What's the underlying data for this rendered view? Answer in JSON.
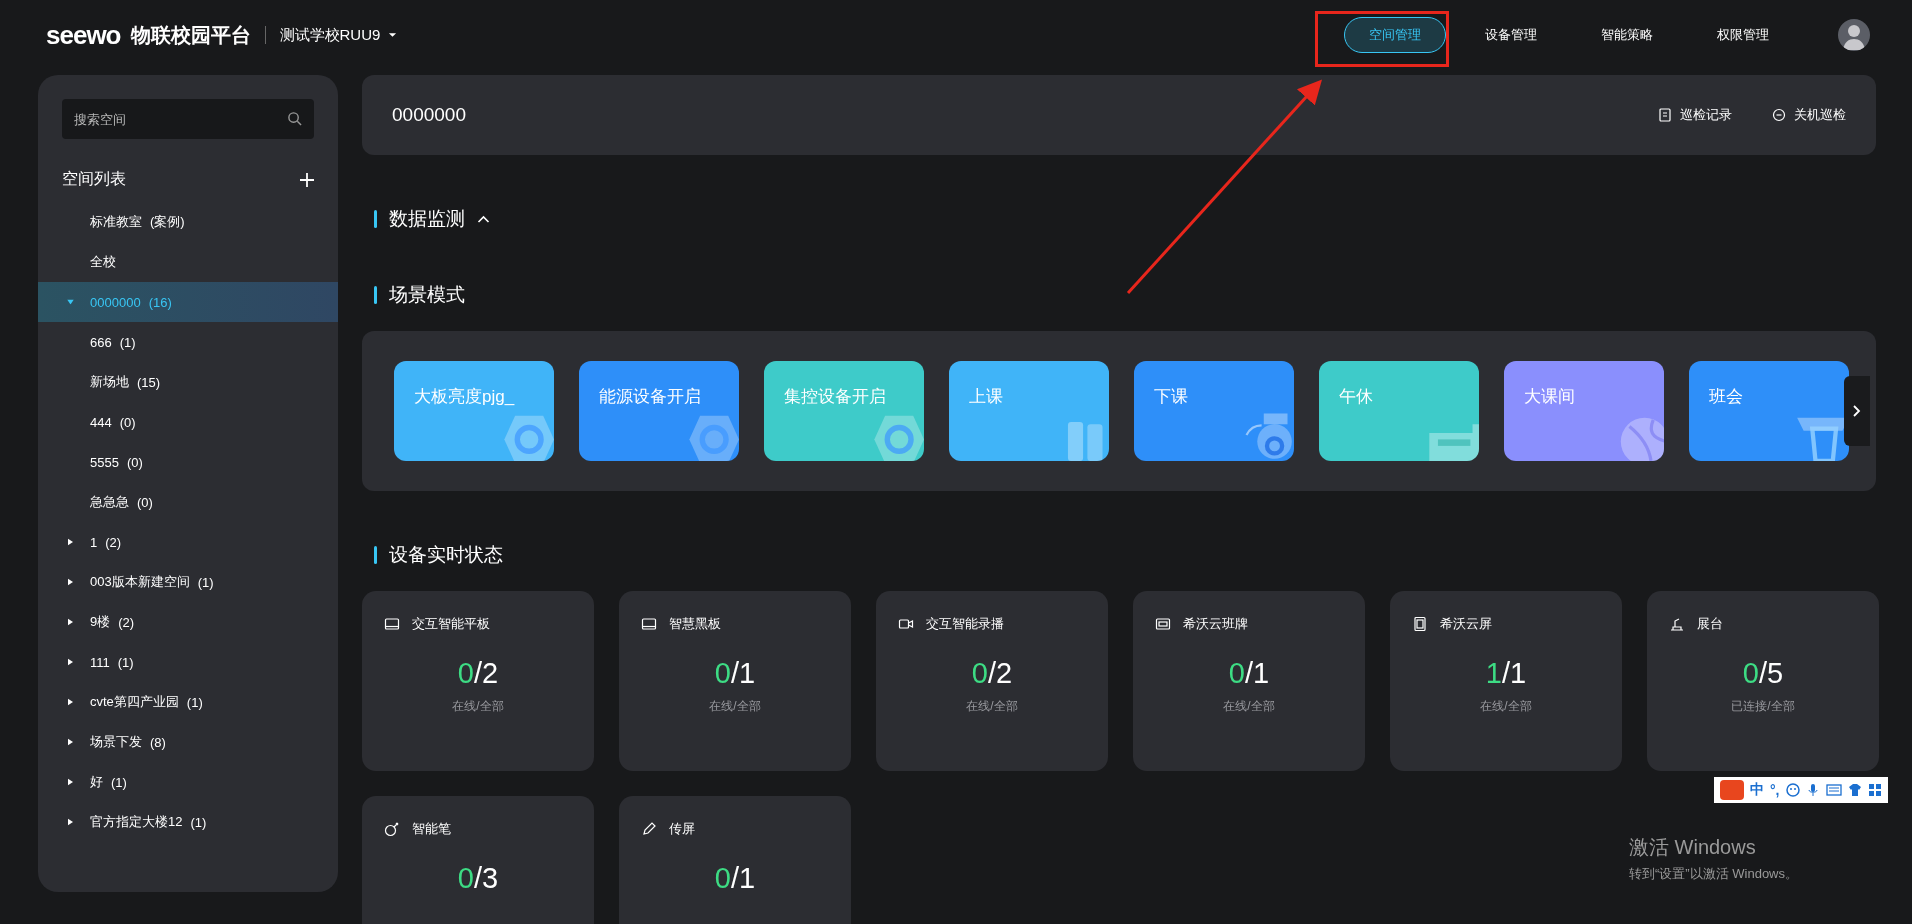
{
  "header": {
    "logo": "seewo",
    "platform": "物联校园平台",
    "school": "测试学校RUU9",
    "nav": [
      {
        "label": "空间管理",
        "selected": true
      },
      {
        "label": "设备管理",
        "selected": false
      },
      {
        "label": "智能策略",
        "selected": false
      },
      {
        "label": "权限管理",
        "selected": false
      }
    ]
  },
  "sidebar": {
    "search": {
      "placeholder": "搜索空间"
    },
    "title": "空间列表",
    "items": [
      {
        "label": "标准教室",
        "count": "(案例)",
        "selected": false
      },
      {
        "label": "全校",
        "selected": false
      },
      {
        "label": "0000000",
        "count": "(16)",
        "expanded": true,
        "selected": true,
        "children": [
          {
            "label": "666",
            "count": "(1)",
            "selected": false
          },
          {
            "label": "新场地",
            "count": "(15)",
            "selected": false
          },
          {
            "label": "444",
            "count": "(0)",
            "selected": false
          },
          {
            "label": "5555",
            "count": "(0)",
            "selected": false
          },
          {
            "label": "急急急",
            "count": "(0)",
            "selected": false
          }
        ]
      },
      {
        "label": "1",
        "count": "(2)",
        "expanded": false,
        "selected": false
      },
      {
        "label": "003版本新建空间",
        "count": "(1)",
        "expanded": false,
        "selected": false
      },
      {
        "label": "9楼",
        "count": "(2)",
        "expanded": false,
        "selected": false
      },
      {
        "label": "111",
        "count": "(1)",
        "expanded": false,
        "selected": false
      },
      {
        "label": "cvte第四产业园",
        "count": "(1)",
        "expanded": false,
        "selected": false
      },
      {
        "label": "场景下发",
        "count": "(8)",
        "expanded": false,
        "selected": false
      },
      {
        "label": "好",
        "count": "(1)",
        "expanded": false,
        "selected": false
      },
      {
        "label": "官方指定大楼12",
        "count": "(1)",
        "expanded": false,
        "selected": false
      }
    ]
  },
  "space": {
    "title": "0000000",
    "actions": [
      {
        "label": "巡检记录",
        "kind": "record"
      },
      {
        "label": "关机巡检",
        "kind": "shutdown"
      }
    ]
  },
  "sections": {
    "monitor": {
      "title": "数据监测",
      "expanded": true
    },
    "scenes": {
      "title": "场景模式"
    },
    "devices": {
      "title": "设备实时状态"
    }
  },
  "scenes": [
    {
      "label": "大板亮度pjg_",
      "color": "#40b4f8",
      "kind": "gear"
    },
    {
      "label": "能源设备开启",
      "color": "#2e8ff9",
      "kind": "gear"
    },
    {
      "label": "集控设备开启",
      "color": "#3ecbc9",
      "kind": "gear"
    },
    {
      "label": "上课",
      "color": "#40b4f8",
      "kind": "books"
    },
    {
      "label": "下课",
      "color": "#2e8ff9",
      "kind": "bell"
    },
    {
      "label": "午休",
      "color": "#3ecbc9",
      "kind": "sofa"
    },
    {
      "label": "大课间",
      "color": "#8a8ffd",
      "kind": "ball"
    },
    {
      "label": "班会",
      "color": "#2e8ff9",
      "kind": "cup"
    }
  ],
  "devices": [
    {
      "name": "交互智能平板",
      "online": "0",
      "total": "/2",
      "caption": "在线/全部",
      "kind": "screen"
    },
    {
      "name": "智慧黑板",
      "online": "0",
      "total": "/1",
      "caption": "在线/全部",
      "kind": "screen"
    },
    {
      "name": "交互智能录播",
      "online": "0",
      "total": "/2",
      "caption": "在线/全部",
      "kind": "camera"
    },
    {
      "name": "希沃云班牌",
      "online": "0",
      "total": "/1",
      "caption": "在线/全部",
      "kind": "sign"
    },
    {
      "name": "希沃云屏",
      "online": "1",
      "total": "/1",
      "caption": "在线/全部",
      "kind": "tablet"
    },
    {
      "name": "展台",
      "online": "0",
      "total": "/5",
      "caption": "已连接/全部",
      "kind": "stand"
    },
    {
      "name": "智能笔",
      "online": "0",
      "total": "/3",
      "kind": "smartpen"
    },
    {
      "name": "传屏",
      "online": "0",
      "total": "/1",
      "kind": "pen"
    }
  ],
  "ime": {
    "label": "中",
    "punct": "°,"
  },
  "os_notice": {
    "title": "激活 Windows",
    "text": "转到“设置”以激活 Windows。"
  }
}
